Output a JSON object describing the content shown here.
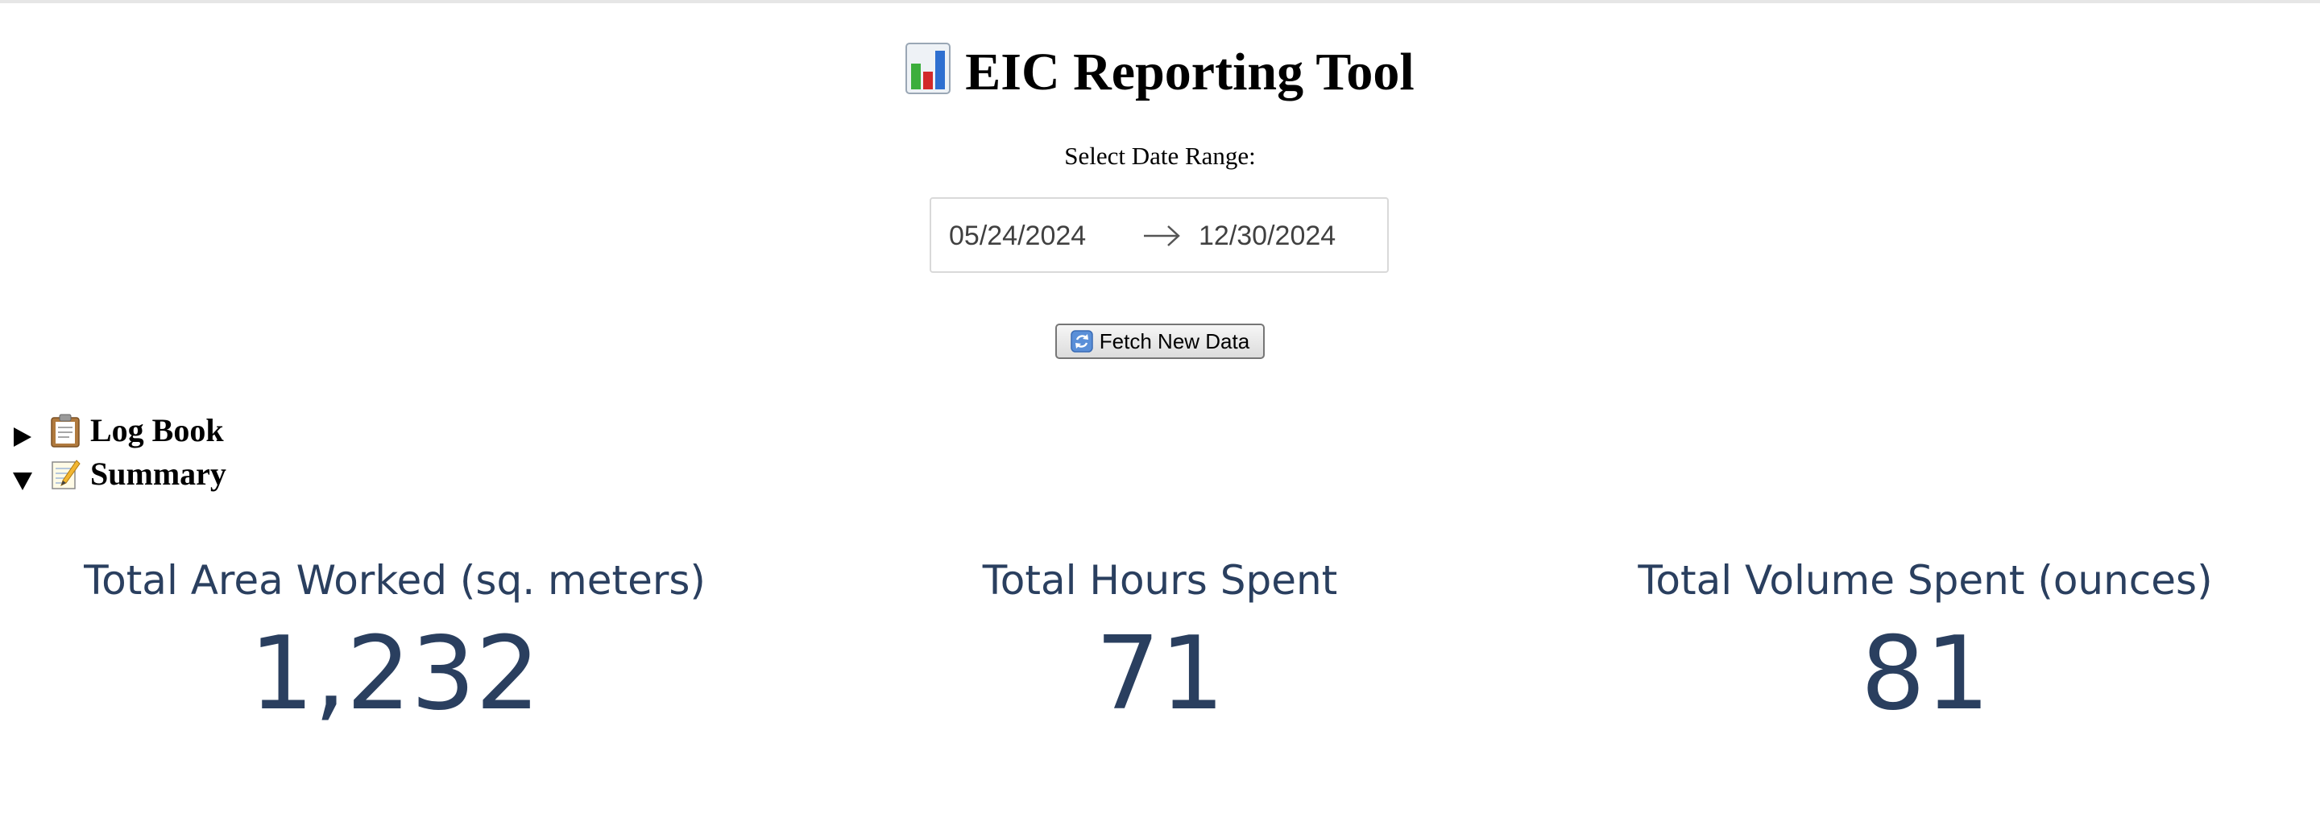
{
  "header": {
    "title": "EIC Reporting Tool",
    "title_icon": "bar-chart-icon"
  },
  "date_range": {
    "label": "Select Date Range:",
    "start": "05/24/2024",
    "end": "12/30/2024",
    "separator_icon": "right-arrow-icon"
  },
  "actions": {
    "fetch_label": "Fetch New Data",
    "fetch_icon": "refresh-icon"
  },
  "sections": {
    "log_book": {
      "label": "Log Book",
      "icon": "clipboard-icon",
      "expanded": false
    },
    "summary": {
      "label": "Summary",
      "icon": "memo-icon",
      "expanded": true
    }
  },
  "metrics": [
    {
      "label": "Total Area Worked (sq. meters)",
      "value": "1,232"
    },
    {
      "label": "Total Hours Spent",
      "value": "71"
    },
    {
      "label": "Total Volume Spent (ounces)",
      "value": "81"
    }
  ],
  "colors": {
    "metric_text": "#2a3f5f",
    "input_border": "#d9d9d9"
  }
}
